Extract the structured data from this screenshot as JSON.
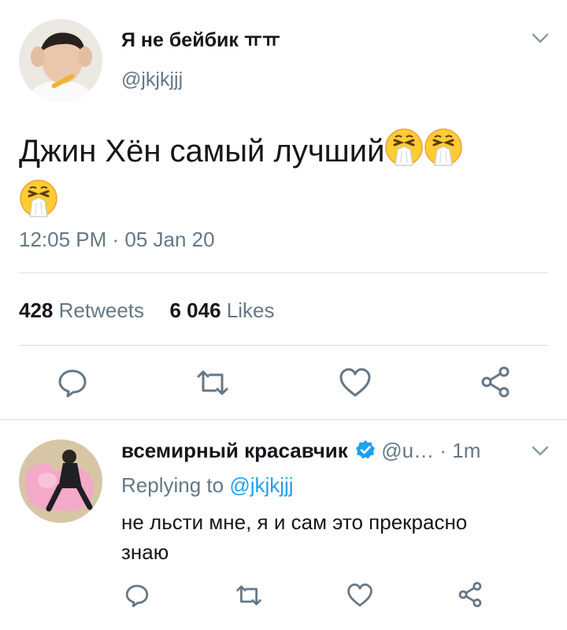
{
  "tweet": {
    "display_name": "Я не бейбик ㅠㅠ",
    "handle": "@jkjkjjj",
    "text": "Джин Хён самый лучший",
    "emoji_count": 3,
    "timestamp": "12:05 PM · 05 Jan 20",
    "retweets_count": "428",
    "retweets_label": "Retweets",
    "likes_count": "6 046",
    "likes_label": "Likes"
  },
  "reply": {
    "display_name": "всемирный красавчик",
    "verified": true,
    "handle": "@u…",
    "time": "· 1m",
    "replying_prefix": "Replying to",
    "replying_handle": "@jkjkjjj",
    "text_line1": "не льсти мне, я и сам это прекрасно",
    "text_line2": "знаю"
  },
  "icons": {
    "menu": "chevron-down-icon",
    "reply": "reply-icon",
    "retweet": "retweet-icon",
    "like": "heart-icon",
    "share": "share-icon",
    "verified": "verified-badge-icon",
    "emoji": "sneezing-face-emoji"
  },
  "colors": {
    "text": "#14171a",
    "secondary": "#657786",
    "link": "#1da1f2",
    "verified": "#1da1f2",
    "divider": "#d8dee3",
    "section_gap": "#e6ecf0"
  }
}
